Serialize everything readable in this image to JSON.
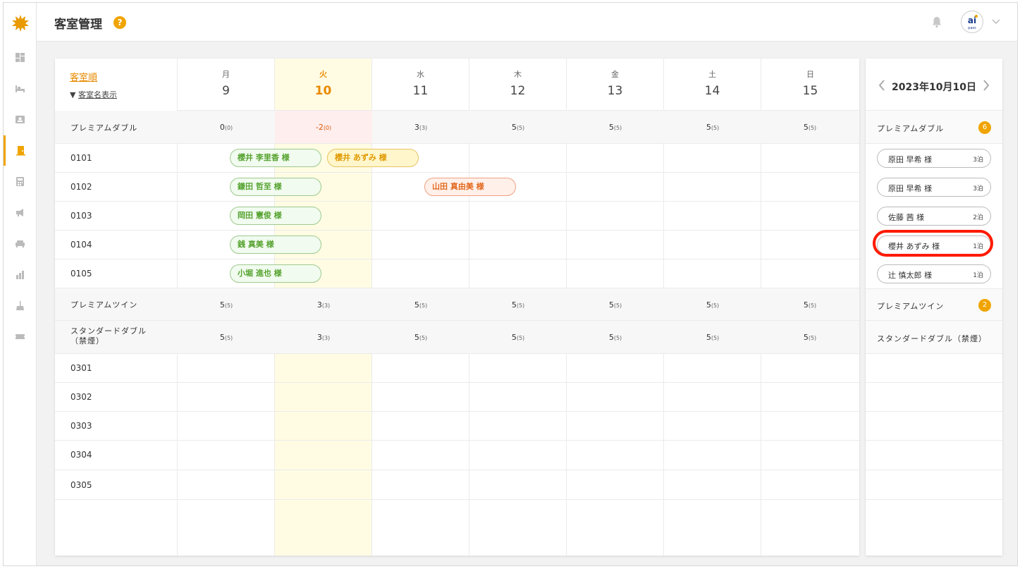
{
  "header": {
    "title": "客室管理",
    "help": "?",
    "avatar_text": "ai",
    "avatar_sub": "pass"
  },
  "sidebar": {
    "items": [
      {
        "icon": "dashboard-icon"
      },
      {
        "icon": "bed-icon"
      },
      {
        "icon": "contacts-icon"
      },
      {
        "icon": "door-icon",
        "active": true
      },
      {
        "icon": "calculator-icon"
      },
      {
        "icon": "megaphone-icon"
      },
      {
        "icon": "sofa-icon"
      },
      {
        "icon": "bar-chart-icon"
      },
      {
        "icon": "cleaning-icon"
      },
      {
        "icon": "ticket-icon"
      }
    ]
  },
  "grid": {
    "sort_label": "客室順",
    "toggle_label": "客室名表示",
    "days": [
      {
        "weekday": "月",
        "day": "9"
      },
      {
        "weekday": "火",
        "day": "10",
        "today": true
      },
      {
        "weekday": "水",
        "day": "11"
      },
      {
        "weekday": "木",
        "day": "12"
      },
      {
        "weekday": "金",
        "day": "13"
      },
      {
        "weekday": "土",
        "day": "14"
      },
      {
        "weekday": "日",
        "day": "15"
      }
    ],
    "room_types": [
      {
        "name": "プレミアムダブル",
        "availability": [
          {
            "v": "0",
            "t": "(0)"
          },
          {
            "v": "-2",
            "t": "(0)"
          },
          {
            "v": "3",
            "t": "(3)"
          },
          {
            "v": "5",
            "t": "(5)"
          },
          {
            "v": "5",
            "t": "(5)"
          },
          {
            "v": "5",
            "t": "(5)"
          },
          {
            "v": "5",
            "t": "(5)"
          }
        ],
        "rooms": [
          "0101",
          "0102",
          "0103",
          "0104",
          "0105"
        ]
      },
      {
        "name": "プレミアムツイン",
        "availability": [
          {
            "v": "5",
            "t": "(5)"
          },
          {
            "v": "3",
            "t": "(3)"
          },
          {
            "v": "5",
            "t": "(5)"
          },
          {
            "v": "5",
            "t": "(5)"
          },
          {
            "v": "5",
            "t": "(5)"
          },
          {
            "v": "5",
            "t": "(5)"
          },
          {
            "v": "5",
            "t": "(5)"
          }
        ],
        "rooms": []
      },
      {
        "name_line1": "スタンダードダブル",
        "name_line2": "（禁煙）",
        "availability": [
          {
            "v": "5",
            "t": "(5)"
          },
          {
            "v": "3",
            "t": "(3)"
          },
          {
            "v": "5",
            "t": "(5)"
          },
          {
            "v": "5",
            "t": "(5)"
          },
          {
            "v": "5",
            "t": "(5)"
          },
          {
            "v": "5",
            "t": "(5)"
          },
          {
            "v": "5",
            "t": "(5)"
          }
        ],
        "rooms": [
          "0301",
          "0302",
          "0303",
          "0304",
          "0305"
        ]
      }
    ],
    "reservations": [
      {
        "room": "0101",
        "name": "櫻井 李里香 様",
        "color": "green"
      },
      {
        "room": "0101",
        "name": "櫻井 あずみ 様",
        "color": "yellow"
      },
      {
        "room": "0102",
        "name": "鎌田 哲至 様",
        "color": "green"
      },
      {
        "room": "0102",
        "name": "山田 真由美 様",
        "color": "orange"
      },
      {
        "room": "0103",
        "name": "岡田 憲俊 様",
        "color": "green"
      },
      {
        "room": "0104",
        "name": "銭 真美 様",
        "color": "green"
      },
      {
        "room": "0105",
        "name": "小堀 進也 様",
        "color": "green"
      }
    ]
  },
  "side_panel": {
    "date": "2023年10月10日",
    "groups": [
      {
        "name": "プレミアムダブル",
        "count": "6",
        "guests": [
          {
            "name": "原田 早希 様",
            "nights": "3泊"
          },
          {
            "name": "原田 早希 様",
            "nights": "3泊"
          },
          {
            "name": "佐藤 茜 様",
            "nights": "2泊"
          },
          {
            "name": "櫻井 あずみ 様",
            "nights": "1泊",
            "highlighted": true
          },
          {
            "name": "辻 慎太郎 様",
            "nights": "1泊"
          }
        ]
      },
      {
        "name": "プレミアムツイン",
        "count": "2"
      },
      {
        "name": "スタンダードダブル（禁煙）"
      }
    ]
  },
  "colors": {
    "accent": "#f0a400",
    "today_bg": "#fffce3",
    "highlight": "#ff1a00"
  }
}
